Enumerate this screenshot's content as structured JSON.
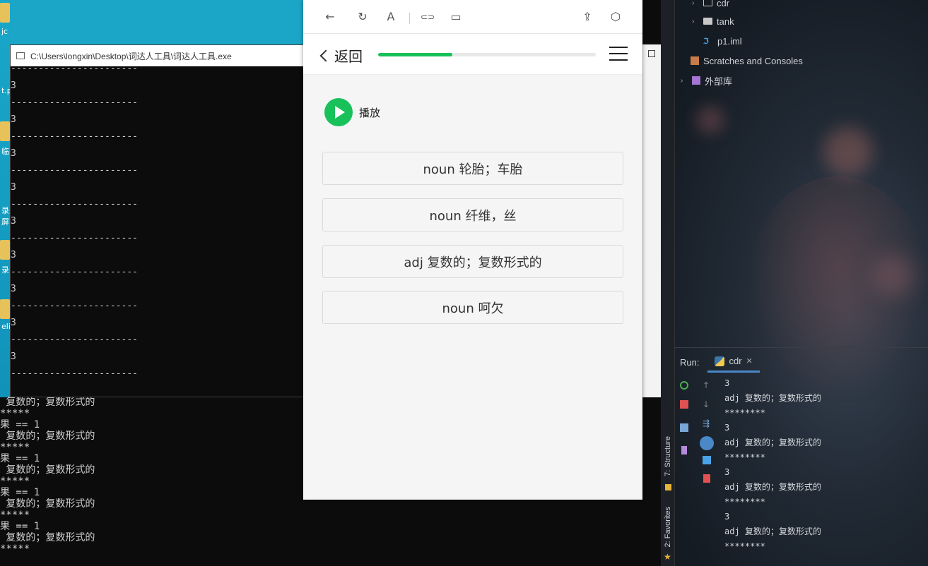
{
  "desktop": {
    "icons": [
      {
        "label": "jc"
      },
      {
        "label": "t.p"
      },
      {
        "label": "临"
      },
      {
        "label": "录屏"
      },
      {
        "label": "录"
      },
      {
        "label": "eli"
      }
    ]
  },
  "console_window": {
    "title": "C:\\Users\\longxin\\Desktop\\词达人工具\\词达人工具.exe",
    "lines": [
      "-----------------------",
      "3",
      "-----------------------",
      "3",
      "-----------------------",
      "3",
      "-----------------------",
      "3",
      "-----------------------",
      "3",
      "-----------------------",
      "3",
      "-----------------------",
      "3",
      "-----------------------",
      "3",
      "-----------------------",
      "3",
      "-----------------------"
    ]
  },
  "bg_console": {
    "lines": [
      " 复数的；复数形式的",
      "*****",
      "果 == 1",
      " 复数的；复数形式的",
      "*****",
      "果 == 1",
      " 复数的；复数形式的",
      "*****",
      "果 == 1",
      " 复数的；复数形式的",
      "*****",
      "果 == 1",
      " 复数的；复数形式的",
      "*****",
      "果 == 1"
    ]
  },
  "browser_toolbar": {
    "back_icon": "←",
    "refresh_icon": "↻",
    "font_icon": "A",
    "link_icon": "⊂⊃",
    "window_icon": "▭",
    "share_icon": "⇪",
    "cube_icon": "⬡"
  },
  "app": {
    "back_label": "返回",
    "progress": 0.34,
    "play_label": "播放",
    "options": [
      "noun 轮胎；车胎",
      "noun 纤维，丝",
      "adj 复数的；复数形式的",
      "noun 呵欠"
    ],
    "colors": {
      "accent": "#18c15a"
    }
  },
  "ide": {
    "tree": [
      {
        "label": "cdr",
        "type": "folder"
      },
      {
        "label": "tank",
        "type": "folder"
      },
      {
        "label": "p1.iml",
        "type": "file"
      },
      {
        "label": "Scratches and Consoles",
        "type": "scratch"
      },
      {
        "label": "外部库",
        "type": "lib"
      }
    ],
    "run_label": "Run:",
    "run_tab": "cdr",
    "structure_tab": "7: Structure",
    "favorites_tab": "2: Favorites",
    "output": [
      "3",
      "adj 复数的；复数形式的",
      "********",
      "3",
      "adj 复数的；复数形式的",
      "********",
      "3",
      "adj 复数的；复数形式的",
      "********",
      "3",
      "adj 复数的；复数形式的",
      "********"
    ]
  }
}
